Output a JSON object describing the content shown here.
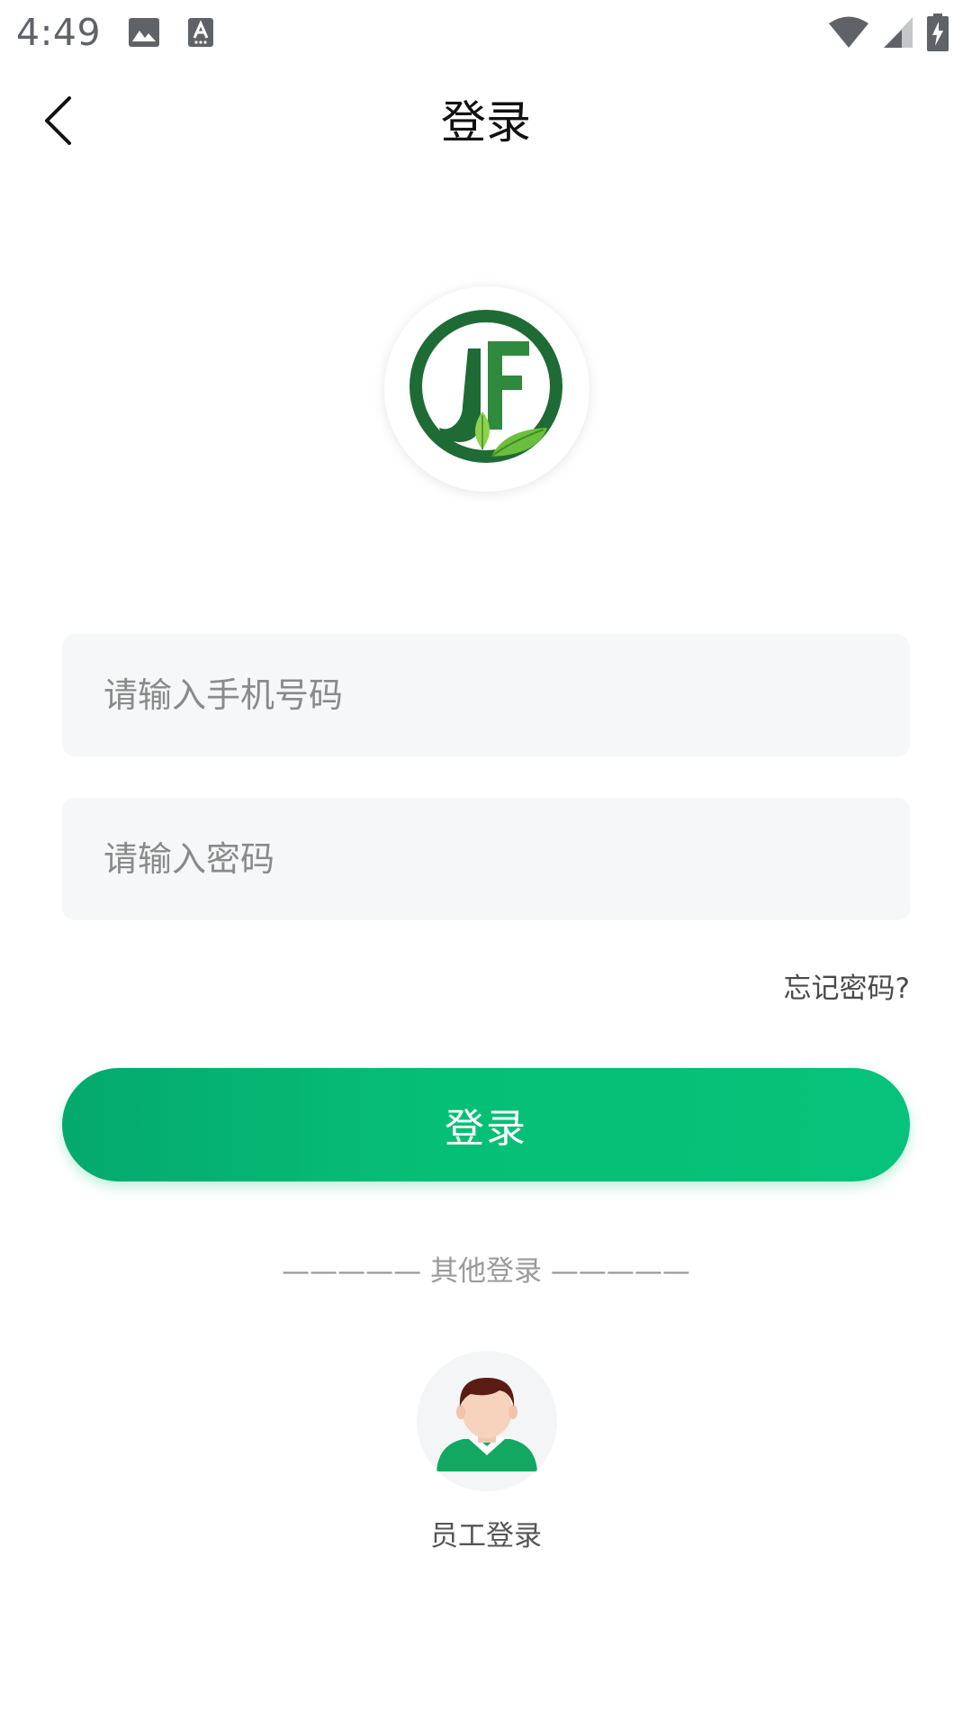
{
  "status_bar": {
    "time": "4:49",
    "icons": [
      "image-icon",
      "text-recognition-icon",
      "wifi-icon",
      "cell-signal-icon",
      "battery-charging-icon"
    ]
  },
  "header": {
    "title": "登录",
    "back_icon": "chevron-left-icon"
  },
  "logo": {
    "brand_letters": "JF"
  },
  "form": {
    "phone_placeholder": "请输入手机号码",
    "password_placeholder": "请输入密码",
    "forgot_password": "忘记密码?",
    "login_button": "登录"
  },
  "other_login": {
    "divider_text": "—————  其他登录  —————",
    "employee_label": "员工登录"
  },
  "colors": {
    "primary_start": "#04a96d",
    "primary_end": "#07c27a",
    "input_bg": "#f6f7f9",
    "logo_dark_green": "#1e6b35",
    "logo_light_green": "#6cbf3c"
  }
}
